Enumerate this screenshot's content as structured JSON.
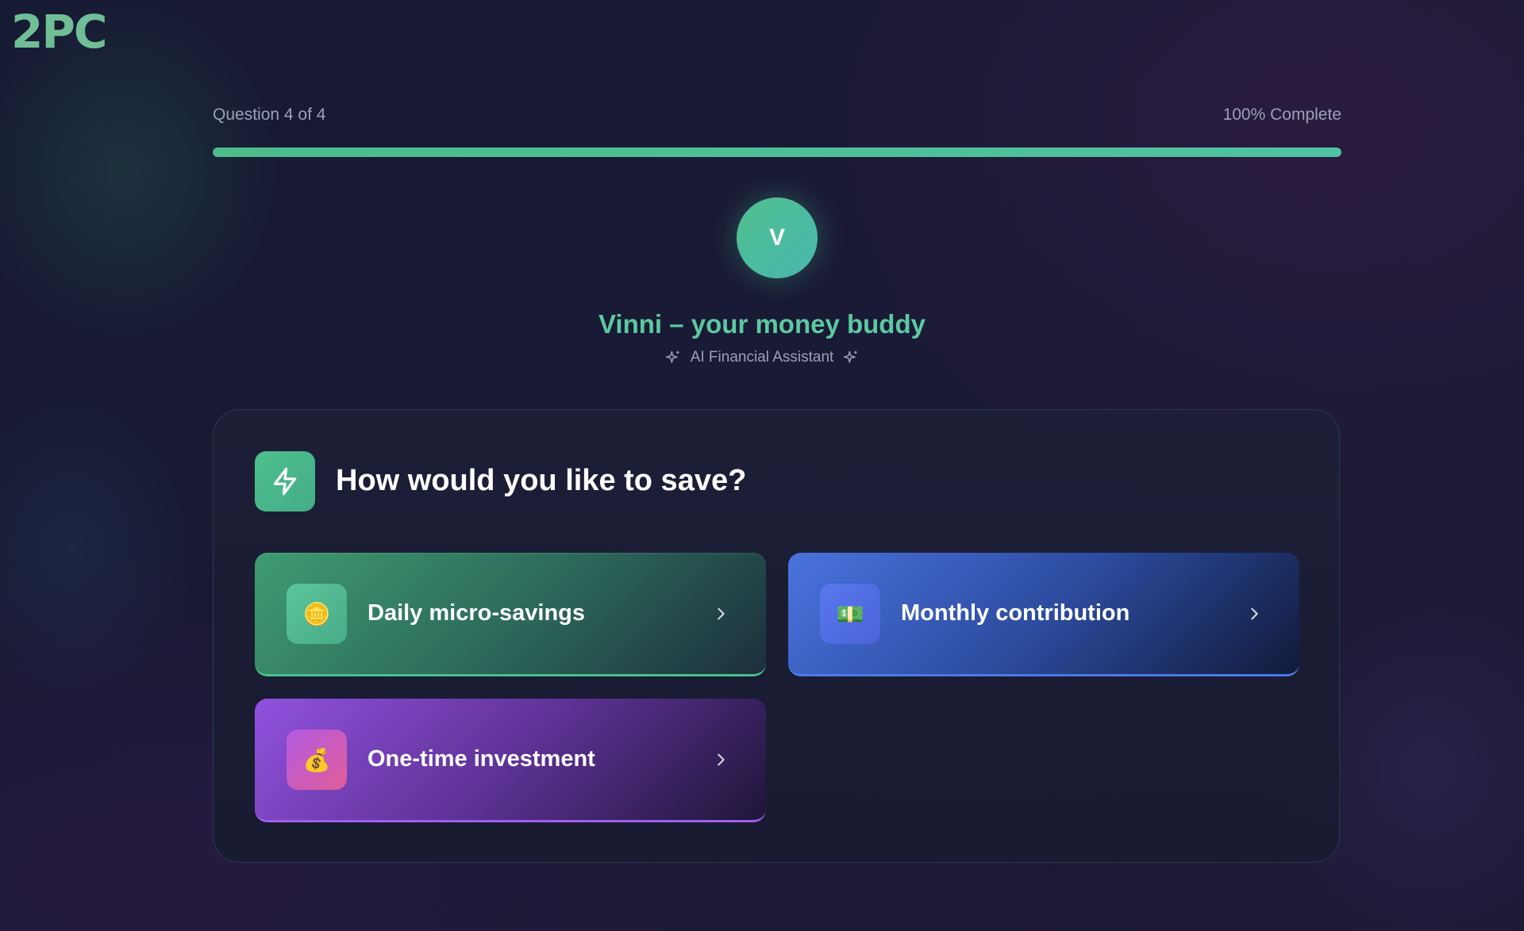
{
  "brand": {
    "logo_text": "2PC",
    "logo_color": "#6fbe96"
  },
  "progress": {
    "question_label": "Question 4 of 4",
    "complete_label": "100% Complete",
    "fraction": 1.0,
    "color": "#4dbb8a"
  },
  "assistant": {
    "avatar_letter": "V",
    "name": "Vinni – your money buddy",
    "subtitle": "AI Financial Assistant",
    "icon_left": "sparkle-icon",
    "icon_right": "sparkle-icon",
    "accent": "#5cc9a0"
  },
  "question": {
    "icon": "lightning-icon",
    "title": "How would you like to save?"
  },
  "options": [
    {
      "label": "Daily micro-savings",
      "icon": "coin-icon",
      "glyph": "🪙",
      "accent": "#4fbf8d"
    },
    {
      "label": "Monthly contribution",
      "icon": "banknote-icon",
      "glyph": "💵",
      "accent": "#4b7ae8"
    },
    {
      "label": "One-time investment",
      "icon": "money-bag-icon",
      "glyph": "💰",
      "accent": "#a05ef0"
    }
  ]
}
